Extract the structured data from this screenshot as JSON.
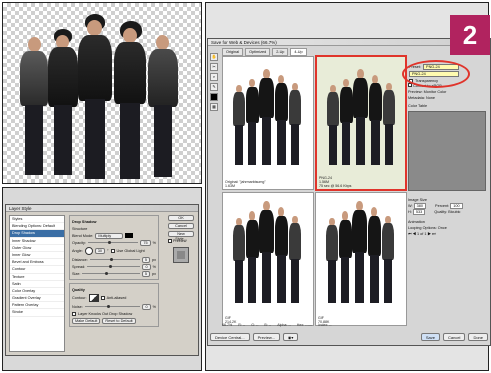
{
  "badge": {
    "number": "2",
    "color": "#b1235f"
  },
  "layer_style": {
    "title": "Layer Style",
    "styles": [
      "Styles",
      "Blending Options: Default",
      "Drop Shadow",
      "Inner Shadow",
      "Outer Glow",
      "Inner Glow",
      "Bevel and Emboss",
      "Contour",
      "Texture",
      "Satin",
      "Color Overlay",
      "Gradient Overlay",
      "Pattern Overlay",
      "Stroke"
    ],
    "selected_index": 2,
    "section_title": "Drop Shadow",
    "structure_label": "Structure",
    "blend_mode_label": "Blend Mode:",
    "blend_mode_value": "Multiply",
    "opacity_label": "Opacity:",
    "opacity_value": "75",
    "angle_label": "Angle:",
    "angle_value": "30",
    "global_light_label": "Use Global Light",
    "distance_label": "Distance:",
    "distance_value": "5",
    "spread_label": "Spread:",
    "spread_value": "0",
    "size_label": "Size:",
    "size_value": "5",
    "quality_label": "Quality",
    "contour_label": "Contour:",
    "antialiased_label": "Anti-aliased",
    "noise_label": "Noise:",
    "noise_value": "0",
    "knockout_label": "Layer Knocks Out Drop Shadow",
    "make_default_label": "Make Default",
    "reset_default_label": "Reset to Default",
    "ok_label": "OK",
    "cancel_label": "Cancel",
    "new_style_label": "New Style...",
    "preview_label": "Preview",
    "percent_unit": "%",
    "px_unit": "px",
    "degree_unit": "°"
  },
  "save_for_web": {
    "title": "Save for Web & Devices (66.7%)",
    "tabs": [
      "Original",
      "Optimized",
      "2-Up",
      "4-Up"
    ],
    "active_tab": 3,
    "quads": [
      {
        "caption1": "Original: \"jahrmarktsumg\"",
        "caption2": "1.63M"
      },
      {
        "caption1": "PNG-24",
        "caption2": "1.56M",
        "caption3": "75 sec @ 56.6 Kbps"
      },
      {
        "caption1": "GIF",
        "caption2": "214.2K"
      },
      {
        "caption1": "GIF",
        "caption2": "70.88K"
      }
    ],
    "preset_label": "Preset:",
    "preset_value": "PNG-24",
    "format_value": "PNG-24",
    "transparency_label": "Transparency",
    "convert_srgb_label": "Convert to sRGB",
    "preview_label": "Preview:",
    "preview_value": "Monitor Color",
    "metadata_label": "Metadata:",
    "metadata_value": "None",
    "color_table_label": "Color Table",
    "image_size_label": "Image Size",
    "width_label": "W:",
    "width_value": "380",
    "height_label": "H:",
    "height_value": "533",
    "percent_label": "Percent:",
    "percent_value": "100",
    "quality_label": "Quality:",
    "quality_value": "Bicubic",
    "animation_label": "Animation",
    "looping_label": "Looping Options:",
    "looping_value": "Once",
    "frame_counter": "1 of 1",
    "zoom_value": "66.7%",
    "status_r": "R: --",
    "status_g": "G: --",
    "status_b": "B: --",
    "status_alpha": "Alpha: --",
    "status_hex": "Hex: ------",
    "status_index": "Index: --",
    "device_central_label": "Device Central...",
    "preview_button_label": "Preview...",
    "save_label": "Save",
    "cancel_label": "Cancel",
    "done_label": "Done",
    "highlight_color": "#e0342b"
  }
}
